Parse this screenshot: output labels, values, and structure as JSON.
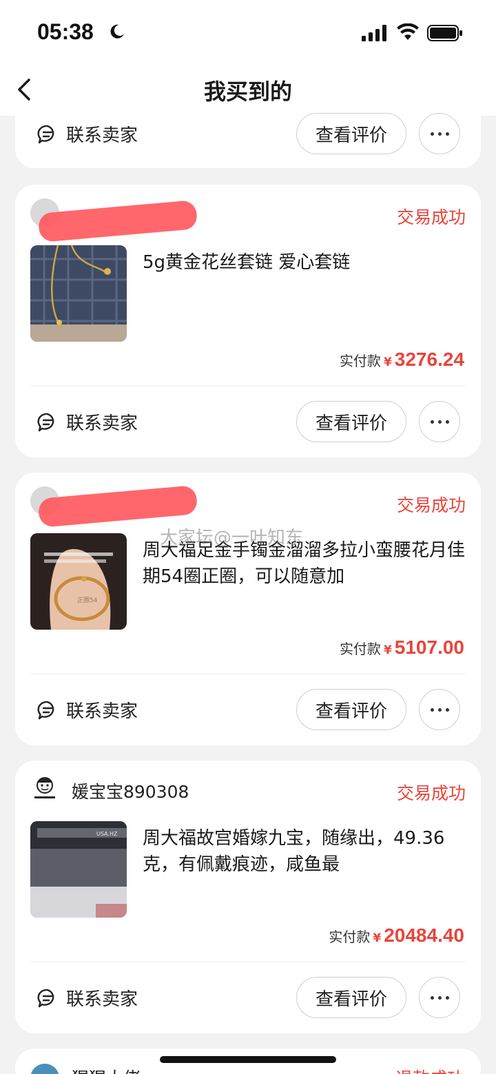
{
  "status_bar": {
    "time": "05:38"
  },
  "nav": {
    "title": "我买到的"
  },
  "common": {
    "contact_label": "联系卖家",
    "review_label": "查看评价",
    "paid_label": "实付款",
    "currency": "¥"
  },
  "orders": [
    {
      "seller": "",
      "status": "交易成功",
      "title": "5g黄金花丝套链 爱心套链",
      "amount": "3276.24"
    },
    {
      "seller": "",
      "status": "交易成功",
      "title": "周大福足金手镯金溜溜多拉小蛮腰花月佳期54圈正圈，可以随意加",
      "amount": "5107.00",
      "thumb_caption": "正圈54"
    },
    {
      "seller": "媛宝宝890308",
      "status": "交易成功",
      "title": "周大福故宫婚嫁九宝，随缘出，49.36克，有佩戴痕迹，咸鱼最",
      "amount": "20484.40",
      "thumb_caption": "USA.HZ"
    }
  ],
  "partial_order": {
    "seller": "猩猩大佬",
    "status": "退款成功"
  },
  "watermark": "大家坛@一叶知东",
  "colors": {
    "accent": "#e8453c",
    "background": "#f2f2f2"
  }
}
